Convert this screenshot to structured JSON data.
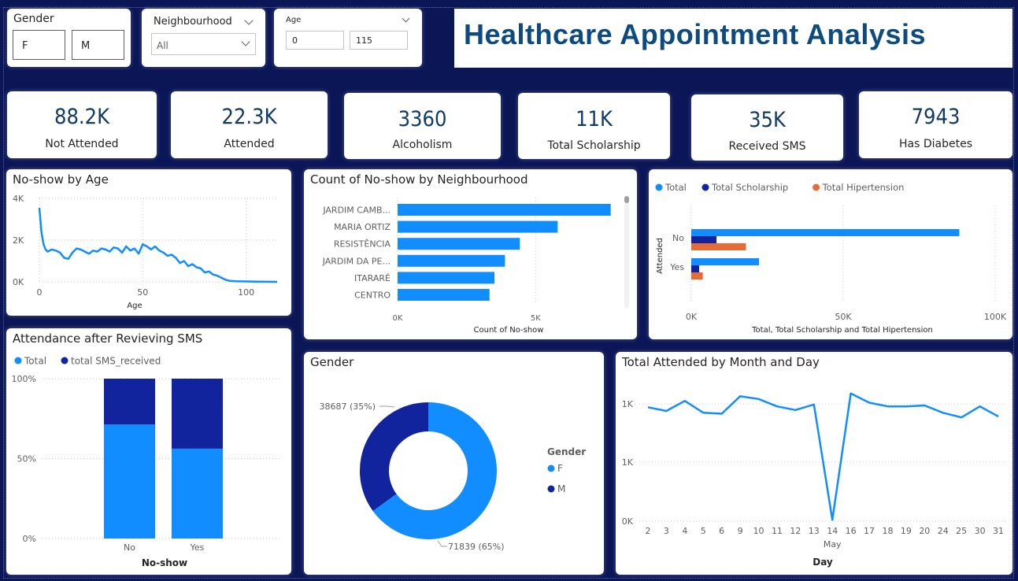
{
  "title": "Healthcare Appointment Analysis",
  "slicers": {
    "gender": {
      "label": "Gender",
      "options": [
        "F",
        "M"
      ]
    },
    "neighbourhood": {
      "label": "Neighbourhood",
      "value": "All"
    },
    "age": {
      "label": "Age",
      "min": "0",
      "max": "115"
    }
  },
  "kpis": [
    {
      "value": "88.2K",
      "label": "Not Attended"
    },
    {
      "value": "22.3K",
      "label": "Attended"
    },
    {
      "value": "3360",
      "label": "Alcoholism"
    },
    {
      "value": "11K",
      "label": "Total Scholarship"
    },
    {
      "value": "35K",
      "label": "Received SMS"
    },
    {
      "value": "7943",
      "label": "Has Diabetes"
    }
  ],
  "colors": {
    "primary": "#118dff",
    "dark": "#12239e",
    "orange": "#e66c37",
    "title": "#0d4a80",
    "background": "#0b1656"
  },
  "chart_data": [
    {
      "id": "noshow_age",
      "type": "line",
      "title": "No-show by Age",
      "xlabel": "Age",
      "ylabel": "",
      "xlim": [
        0,
        115
      ],
      "ylim": [
        0,
        4000
      ],
      "xticks": [
        "0",
        "50",
        "100"
      ],
      "yticks": [
        "0K",
        "2K",
        "4K"
      ],
      "x": [
        0,
        1,
        2,
        3,
        4,
        5,
        6,
        8,
        10,
        12,
        14,
        16,
        18,
        20,
        22,
        24,
        26,
        28,
        30,
        32,
        34,
        36,
        38,
        40,
        42,
        44,
        46,
        48,
        50,
        52,
        54,
        56,
        58,
        60,
        62,
        64,
        66,
        68,
        70,
        72,
        74,
        76,
        78,
        80,
        82,
        84,
        86,
        88,
        90,
        92,
        95,
        100,
        105,
        110,
        115
      ],
      "values": [
        3550,
        2400,
        1800,
        1550,
        1450,
        1500,
        1550,
        1500,
        1400,
        1150,
        1100,
        1400,
        1600,
        1550,
        1450,
        1350,
        1500,
        1450,
        1600,
        1550,
        1450,
        1650,
        1600,
        1400,
        1700,
        1500,
        1600,
        1350,
        1800,
        1700,
        1550,
        1700,
        1500,
        1400,
        1250,
        1300,
        1150,
        900,
        1000,
        750,
        850,
        700,
        650,
        450,
        500,
        350,
        300,
        200,
        100,
        50,
        30,
        20,
        10,
        5,
        0
      ]
    },
    {
      "id": "noshow_neighbourhood",
      "type": "bar",
      "title": "Count of No-show by Neighbourhood",
      "xlabel": "Count of No-show",
      "categories": [
        "JARDIM CAMB...",
        "MARIA ORTIZ",
        "RESISTÊNCIA",
        "JARDIM DA PE...",
        "ITARARÉ",
        "CENTRO"
      ],
      "values": [
        7720,
        5800,
        4430,
        3890,
        3510,
        3330
      ],
      "xlim": [
        0,
        8500
      ],
      "xticks": [
        "0K",
        "5K"
      ]
    },
    {
      "id": "attended_totals",
      "type": "bar",
      "title": "",
      "xlabel": "Total, Total Scholarship and Total Hipertension",
      "ylabel": "Attended",
      "categories": [
        "No",
        "Yes"
      ],
      "series": [
        {
          "name": "Total",
          "values": [
            88200,
            22300
          ]
        },
        {
          "name": "Total Scholarship",
          "values": [
            8300,
            2600
          ]
        },
        {
          "name": "Total Hipertension",
          "values": [
            18000,
            3800
          ]
        }
      ],
      "xlim": [
        0,
        100000
      ],
      "xticks": [
        "0K",
        "50K",
        "100K"
      ]
    },
    {
      "id": "sms_attendance",
      "type": "bar",
      "title": "Attendance after Revieving SMS",
      "xlabel": "No-show",
      "categories": [
        "No",
        "Yes"
      ],
      "series": [
        {
          "name": "Total",
          "values": [
            71.3,
            56.2
          ]
        },
        {
          "name": "total SMS_received",
          "values": [
            28.7,
            43.8
          ]
        }
      ],
      "ylim": [
        0,
        100
      ],
      "yticks": [
        "0%",
        "50%",
        "100%"
      ]
    },
    {
      "id": "gender",
      "type": "pie",
      "title": "Gender",
      "legend_title": "Gender",
      "categories": [
        "F",
        "M"
      ],
      "values": [
        71839,
        38687
      ],
      "labels": [
        "71839 (65%)",
        "38687 (35%)"
      ]
    },
    {
      "id": "attended_day",
      "type": "line",
      "title": "Total Attended by Month and Day",
      "xlabel": "Day",
      "xsublabel": "May",
      "categories": [
        "2",
        "3",
        "4",
        "5",
        "6",
        "9",
        "10",
        "11",
        "12",
        "13",
        "14",
        "16",
        "17",
        "18",
        "19",
        "20",
        "24",
        "25",
        "30",
        "31"
      ],
      "values": [
        1240,
        1200,
        1310,
        1180,
        1170,
        1360,
        1330,
        1250,
        1210,
        1270,
        15,
        1390,
        1290,
        1250,
        1250,
        1260,
        1180,
        1130,
        1250,
        1140
      ],
      "ylim": [
        0,
        1500
      ],
      "yticks": [
        "0K",
        "1K",
        "1K"
      ]
    }
  ]
}
